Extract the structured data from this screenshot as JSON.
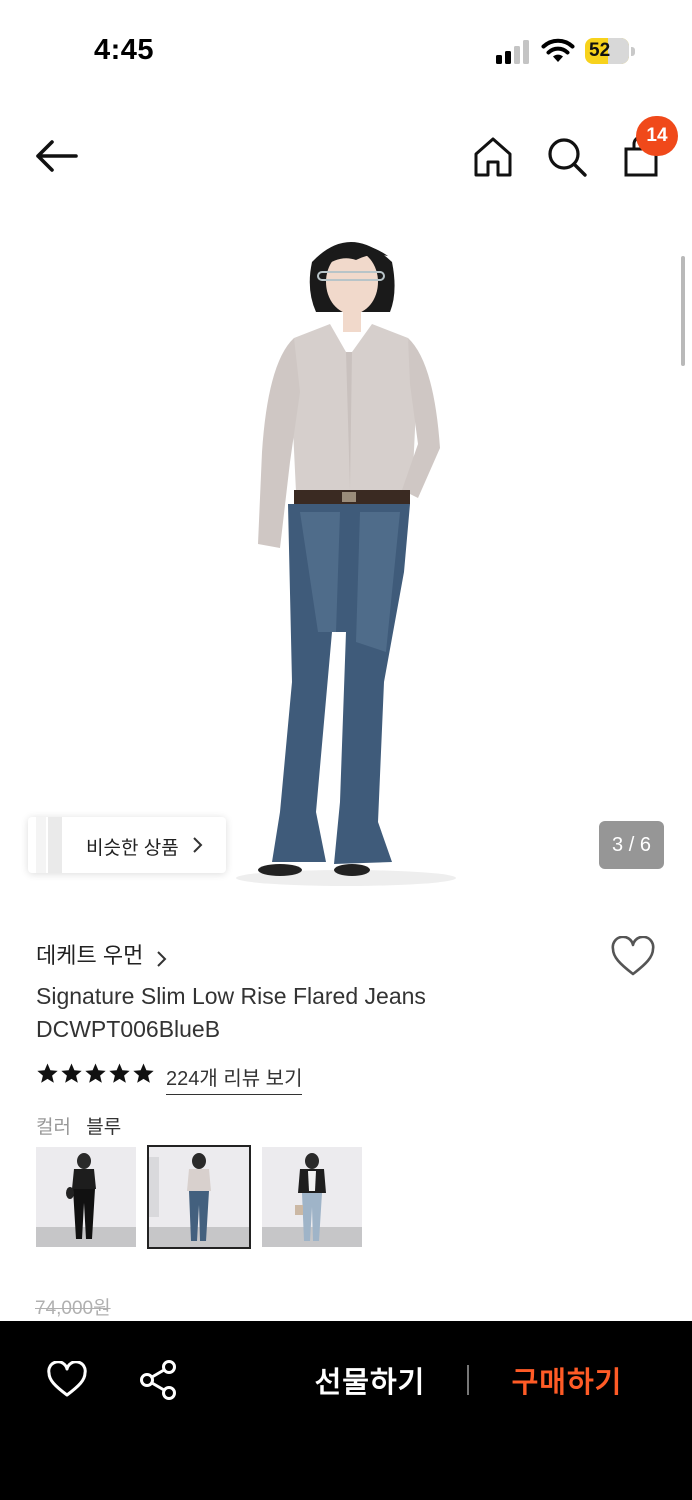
{
  "status_bar": {
    "time": "4:45",
    "battery_percent": "52",
    "battery_level": 0.52
  },
  "nav": {
    "cart_badge": "14"
  },
  "hero": {
    "similar_label": "비슷한 상품",
    "page_indicator": "3 / 6"
  },
  "product": {
    "brand": "데케트 우먼",
    "name": "Signature Slim Low Rise Flared Jeans DCWPT006BlueB",
    "rating_stars": 5,
    "reviews_link": "224개 리뷰 보기",
    "color_label": "컬러",
    "color_value": "블루",
    "swatch_selected_index": 1,
    "original_price": "74,000원"
  },
  "bottom_bar": {
    "gift_label": "선물하기",
    "buy_label": "구매하기"
  },
  "colors": {
    "accent": "#ff5b26",
    "badge": "#f0491a",
    "bottom_bar_bg": "#000000"
  },
  "icons": [
    "back-arrow-icon",
    "home-icon",
    "search-icon",
    "shopping-bag-icon",
    "heart-icon",
    "share-icon",
    "star-icon",
    "chevron-right-icon"
  ]
}
